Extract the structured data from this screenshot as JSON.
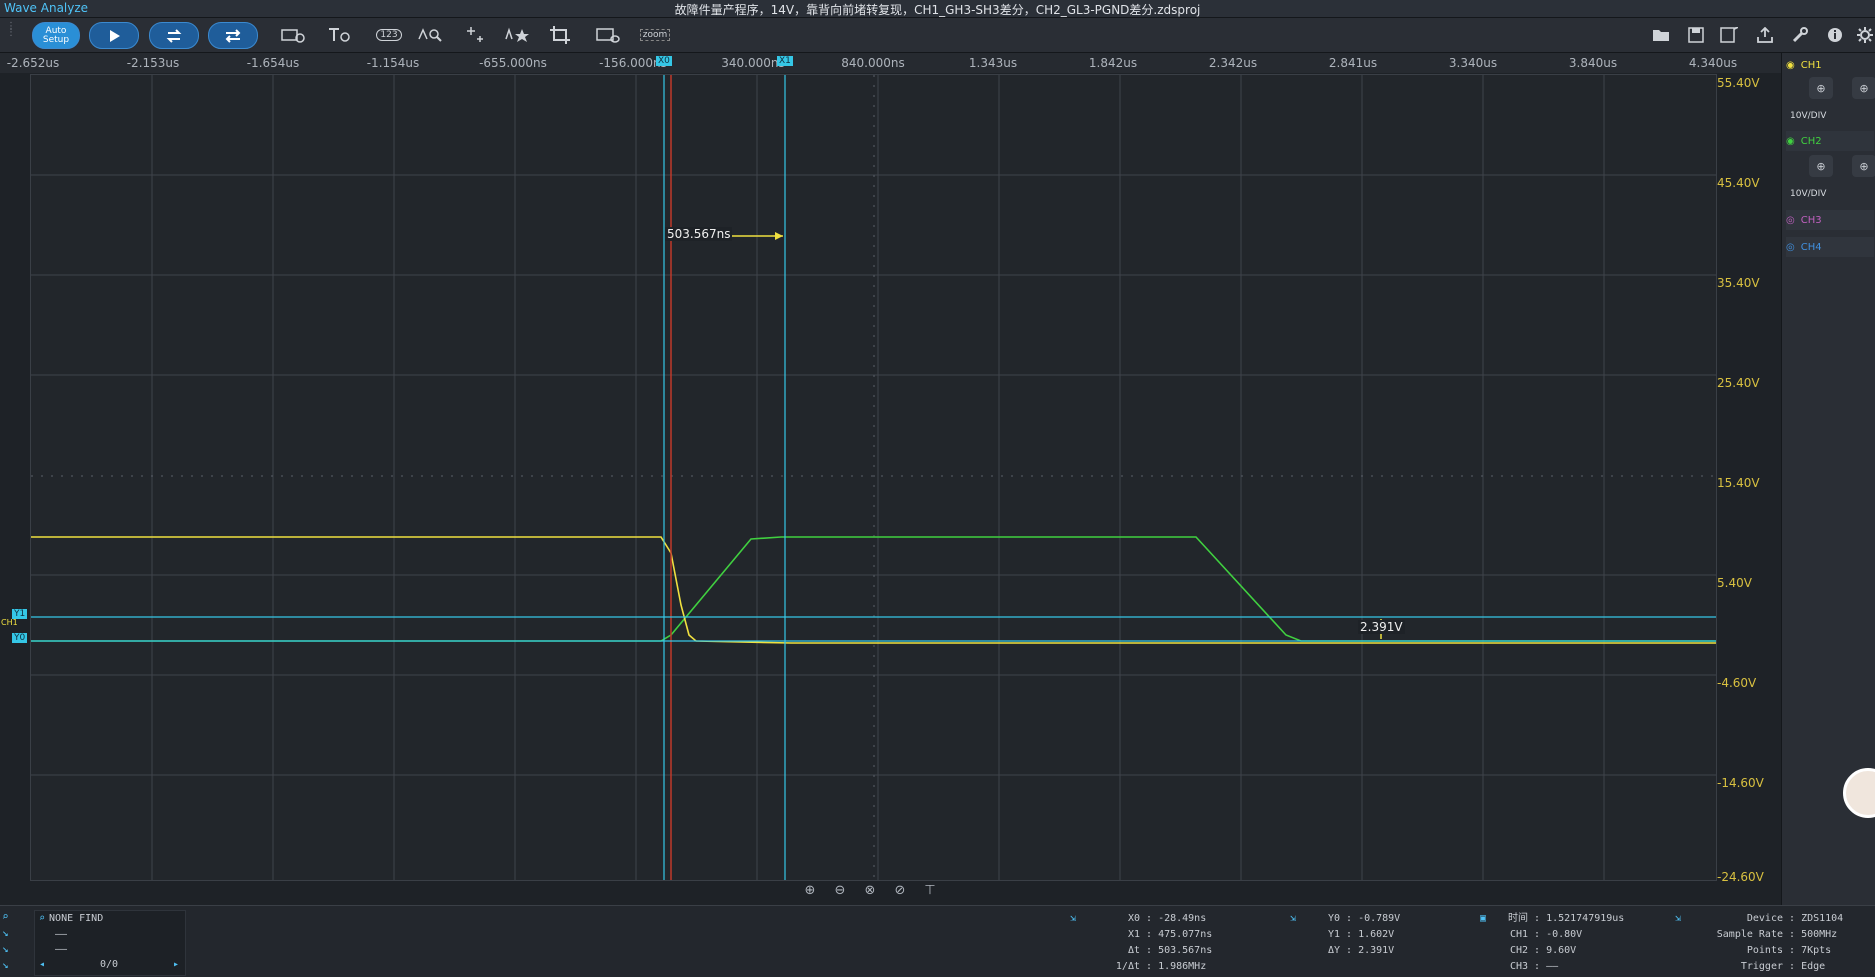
{
  "app": {
    "name": "Wave Analyze",
    "title": "故障件量产程序，14V，靠背向前堵转复现，CH1_GH3-SH3差分，CH2_GL3-PGND差分.zdsproj"
  },
  "toolbar": {
    "auto_setup": "Auto\nSetup",
    "auto_setup_line1": "Auto",
    "auto_setup_line2": "Setup",
    "zoom_label": "zoom",
    "counter_label": "123"
  },
  "time_axis": [
    "-2.652us",
    "-2.153us",
    "-1.654us",
    "-1.154us",
    "-655.000ns",
    "-156.000ns",
    "340.000ns",
    "840.000ns",
    "1.343us",
    "1.842us",
    "2.342us",
    "2.841us",
    "3.340us",
    "3.840us",
    "4.340us"
  ],
  "volt_axis": [
    "55.40V",
    "45.40V",
    "35.40V",
    "25.40V",
    "15.40V",
    "5.40V",
    "-4.60V",
    "-14.60V",
    "-24.60V"
  ],
  "cursors": {
    "x0_label": "X0",
    "x1_label": "X1",
    "y0_label": "Y0",
    "y1_label": "Y1",
    "dt_readout": "503.567ns",
    "dy_readout": "2.391V",
    "ch_marker": "CH1"
  },
  "channels": [
    {
      "name": "CH1",
      "scale": "10V/DIV",
      "color": "#f0e040",
      "enabled": true
    },
    {
      "name": "CH2",
      "scale": "10V/DIV",
      "color": "#40d040",
      "enabled": true
    },
    {
      "name": "CH3",
      "color": "#c060c0",
      "enabled": false
    },
    {
      "name": "CH4",
      "color": "#4090e0",
      "enabled": false
    }
  ],
  "find": {
    "status": "NONE FIND",
    "line1": "——",
    "line2": "——",
    "counter": "0/0"
  },
  "x_measure": {
    "x0_key": "X0",
    "x0": "-28.49ns",
    "x1_key": "X1",
    "x1": "475.077ns",
    "dt_key": "Δt",
    "dt": "503.567ns",
    "inv_key": "1/Δt",
    "inv": "1.986MHz"
  },
  "y_measure": {
    "y0_key": "Y0",
    "y0": "-0.789V",
    "y1_key": "Y1",
    "y1": "1.602V",
    "dy_key": "ΔY",
    "dy": "2.391V"
  },
  "time_info": {
    "time_key": "时间",
    "time": "1.521747919us",
    "ch1_key": "CH1",
    "ch1": "-0.80V",
    "ch2_key": "CH2",
    "ch2": "9.60V",
    "ch3_key": "CH3",
    "ch3": "——"
  },
  "device_info": {
    "device_key": "Device",
    "device": "ZDS1104",
    "rate_key": "Sample Rate",
    "rate": "500MHz",
    "points_key": "Points",
    "points": "7Kpts",
    "trigger_key": "Trigger",
    "trigger": "Edge"
  },
  "colors": {
    "accent": "#4fc3f7",
    "cursor": "#35c7e6",
    "trigger_line": "#c0392b",
    "ch1": "#f0e040",
    "ch2": "#40d040"
  },
  "icons": [
    "open-folder-icon",
    "save-icon",
    "save-as-icon",
    "export-icon",
    "wrench-icon",
    "info-icon",
    "settings-icon"
  ]
}
